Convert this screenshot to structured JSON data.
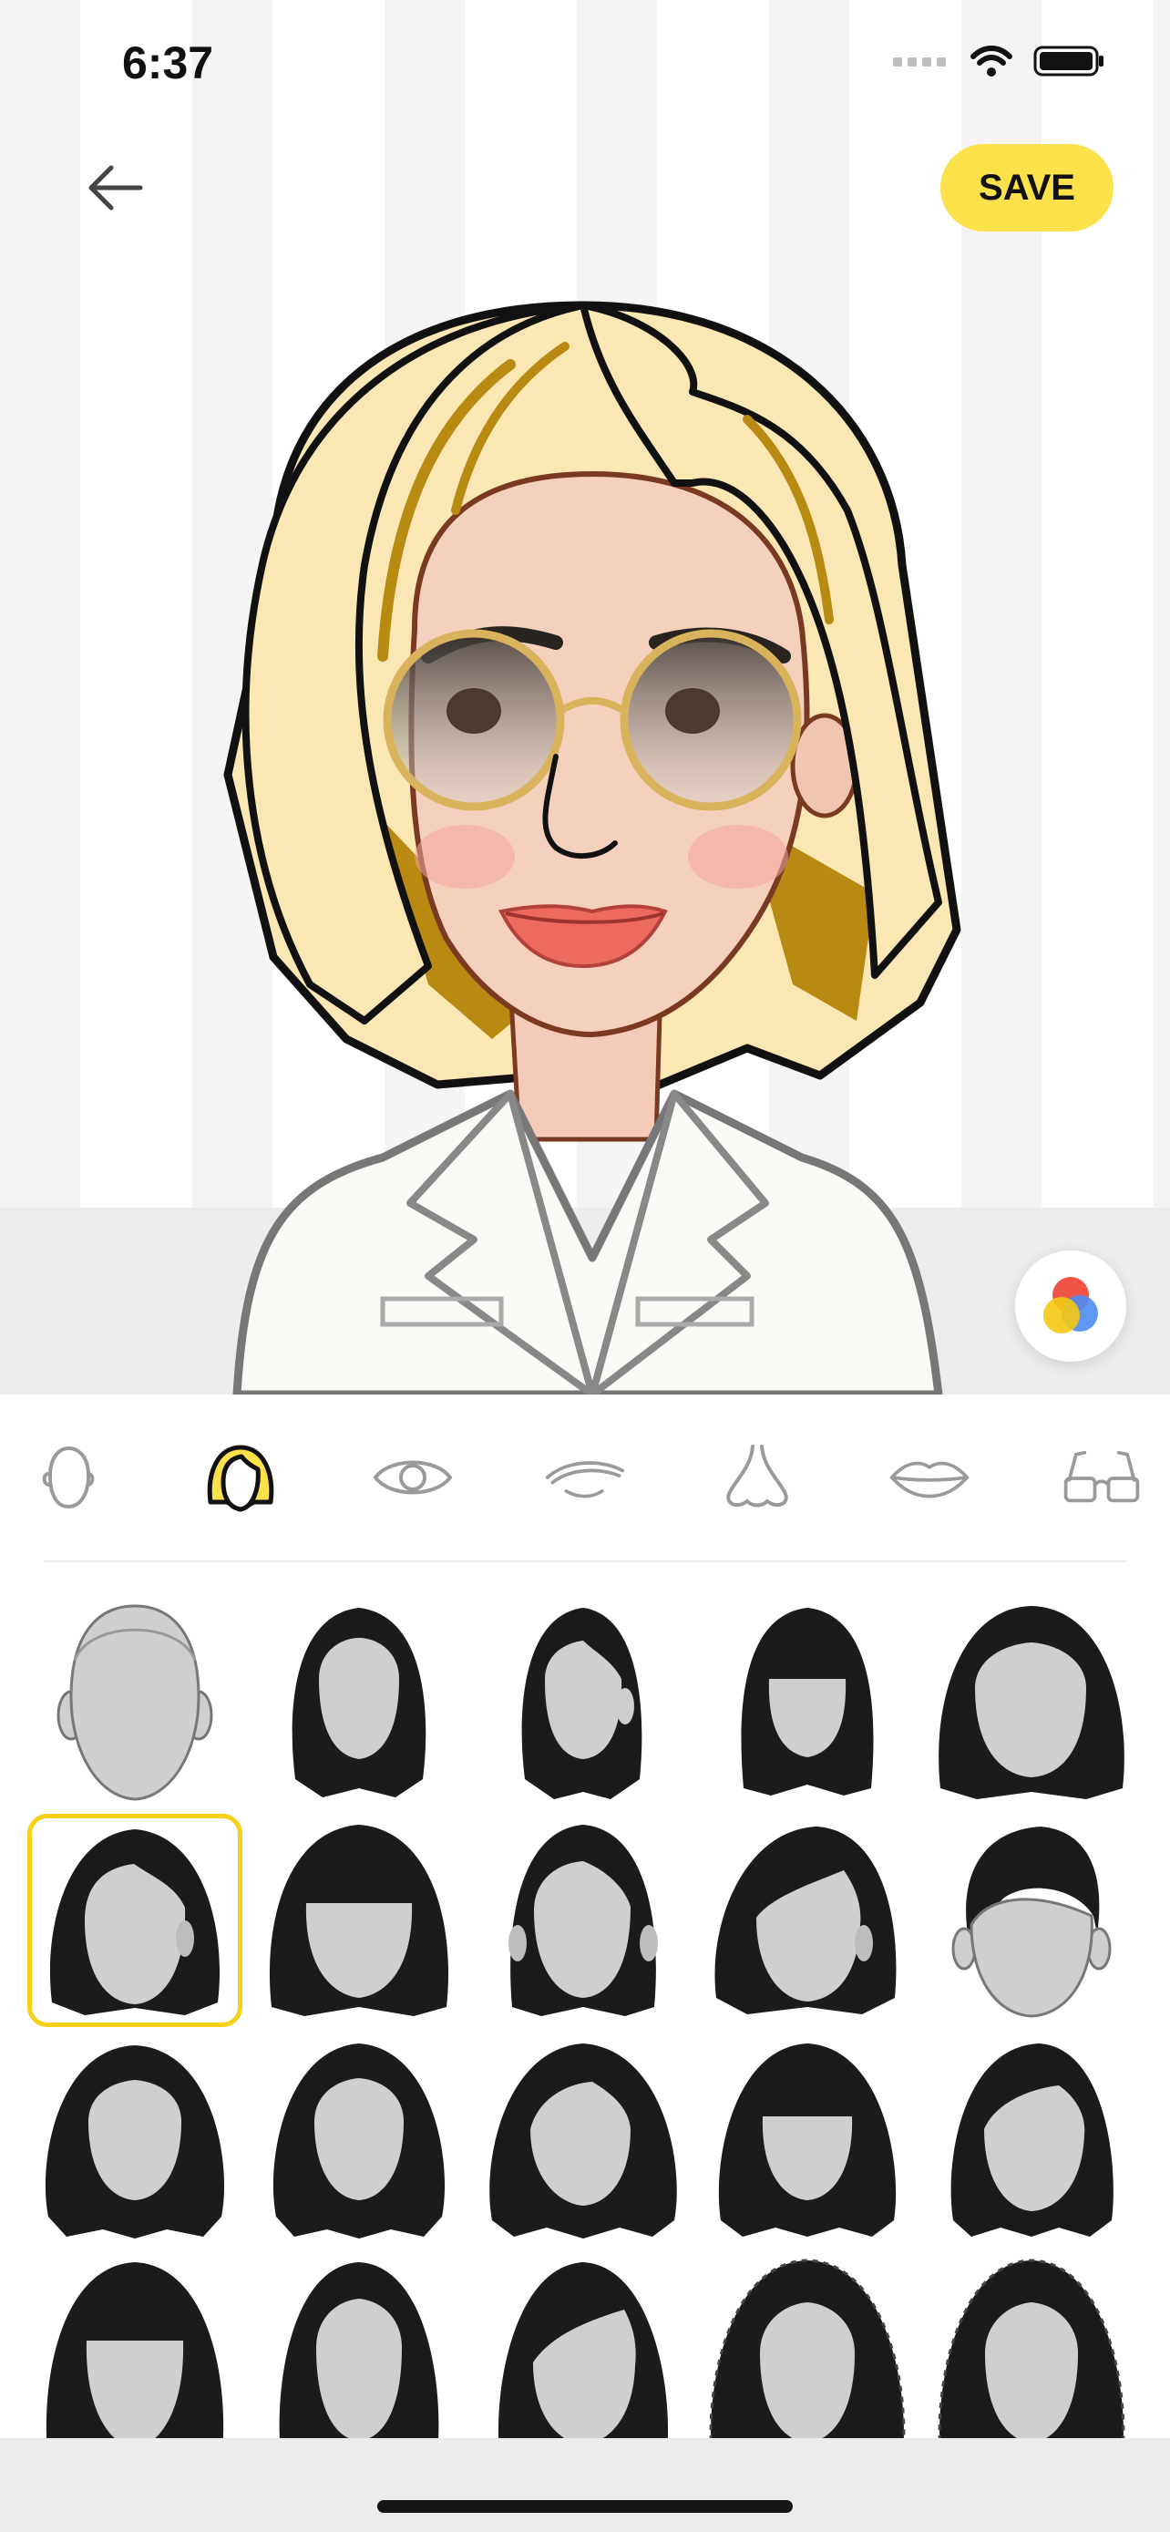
{
  "status": {
    "time": "6:37"
  },
  "header": {
    "save_label": "SAVE"
  },
  "colors": {
    "accent": "#fde14a",
    "selected_border": "#f5cf18"
  },
  "categories": [
    {
      "id": "face",
      "icon": "face-shape-icon"
    },
    {
      "id": "hair",
      "icon": "hair-icon",
      "selected": true
    },
    {
      "id": "eyes",
      "icon": "eye-icon"
    },
    {
      "id": "eyebrows",
      "icon": "eyebrow-icon"
    },
    {
      "id": "nose",
      "icon": "nose-icon"
    },
    {
      "id": "lips",
      "icon": "lips-icon"
    },
    {
      "id": "glasses",
      "icon": "glasses-icon"
    }
  ],
  "hair_styles": {
    "selected_index": 5,
    "count_visible": 20
  }
}
